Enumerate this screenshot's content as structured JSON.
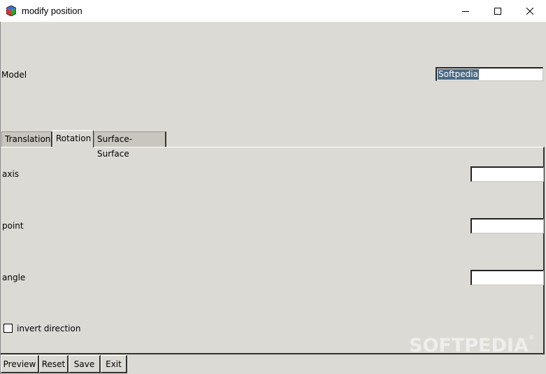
{
  "window": {
    "title": "modify position",
    "icon": "cube-app-icon",
    "controls": {
      "minimize": "minimize-icon",
      "maximize": "maximize-icon",
      "close": "close-icon"
    }
  },
  "model": {
    "label": "Model",
    "value": "Softpedia"
  },
  "tabs": [
    {
      "label": "Translation",
      "active": false
    },
    {
      "label": "Rotation",
      "active": true
    },
    {
      "label": "Surface-Surface",
      "active": false
    }
  ],
  "rotation": {
    "fields": [
      {
        "label": "axis",
        "value": ""
      },
      {
        "label": "point",
        "value": ""
      },
      {
        "label": "angle",
        "value": ""
      }
    ],
    "invert_direction": {
      "label": "invert direction",
      "checked": false
    }
  },
  "buttons": {
    "preview": "Preview",
    "reset": "Reset",
    "save": "Save",
    "exit": "Exit"
  },
  "watermark": "SOFTPEDIA"
}
